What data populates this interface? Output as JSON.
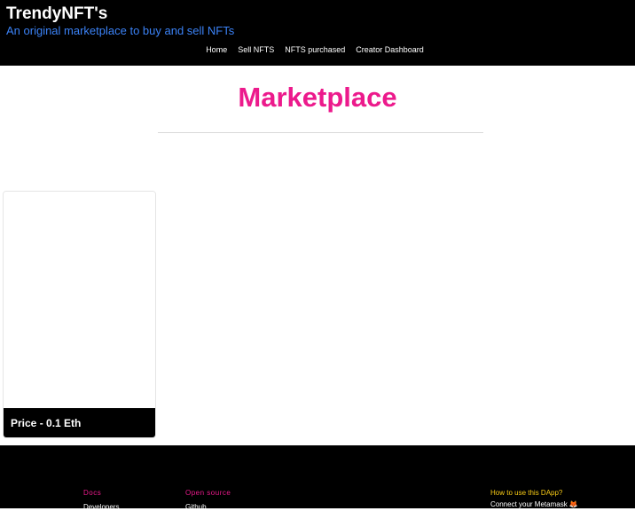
{
  "header": {
    "title": "TrendyNFT's",
    "tagline": "An original marketplace to buy and sell NFTs",
    "nav": [
      {
        "label": "Home"
      },
      {
        "label": "Sell NFTS"
      },
      {
        "label": "NFTS purchased"
      },
      {
        "label": "Creator Dashboard"
      }
    ]
  },
  "main": {
    "title": "Marketplace",
    "cards": [
      {
        "price_label": "Price - 0.1 Eth"
      }
    ]
  },
  "footer": {
    "columns": [
      {
        "heading": "Docs",
        "link": "Developers"
      },
      {
        "heading": "Open source",
        "link": "Github"
      }
    ],
    "help": {
      "heading": "How to use this DApp?",
      "link": "Connect your Metamask 🦊"
    }
  },
  "colors": {
    "header_bg": "#000000",
    "tagline": "#3b82f6",
    "title_accent": "#ec1a8c",
    "help_heading": "#facc15"
  }
}
